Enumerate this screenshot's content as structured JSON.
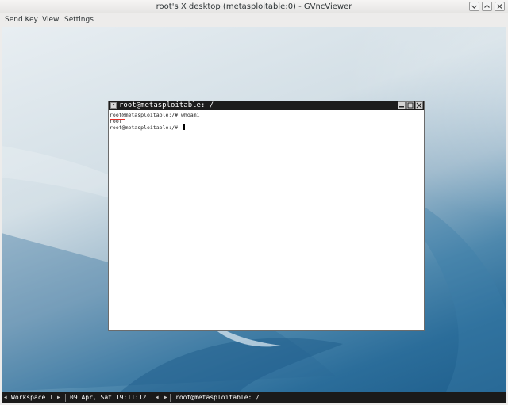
{
  "window": {
    "title": "root's X desktop (metasploitable:0) - GVncViewer",
    "controls": [
      "minimize-icon",
      "maximize-icon",
      "close-icon"
    ]
  },
  "menubar": {
    "items": [
      "Send Key",
      "View",
      "Settings"
    ]
  },
  "xterm": {
    "title": "root@metasploitable: /",
    "lines": [
      "root@metasploitable:/# whoami",
      "root",
      "root@metasploitable:/# "
    ],
    "highlight_color": "#e0312a"
  },
  "panel": {
    "workspace": "Workspace 1",
    "datetime": "09 Apr, Sat 19:11:12",
    "task": "root@metasploitable: /"
  },
  "colors": {
    "desktop_accent": "#2b6d9a",
    "panel_bg": "#1a1a1a"
  }
}
